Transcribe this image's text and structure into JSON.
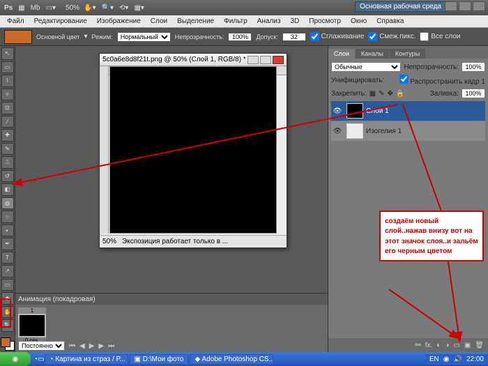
{
  "titlebar": {
    "ps": "Ps",
    "zoom": "50%",
    "workspace": "Основная рабочая среда"
  },
  "menu": {
    "file": "Файл",
    "edit": "Редактирование",
    "image": "Изображение",
    "layer": "Слои",
    "select": "Выделение",
    "filter": "Фильтр",
    "analysis": "Анализ",
    "view3d": "3D",
    "view": "Просмотр",
    "window": "Окно",
    "help": "Справка"
  },
  "options": {
    "fg_label": "Основной цвет",
    "mode_label": "Режим:",
    "mode_value": "Нормальный",
    "opacity_label": "Непрозрачность:",
    "opacity_value": "100%",
    "tolerance_label": "Допуск:",
    "tolerance_value": "32",
    "antialias": "Сглаживание",
    "contiguous": "Смеж.пикс.",
    "alllayers": "Все слои"
  },
  "document": {
    "title": "5c0a6e8d8f21t.png @ 50% (Слой 1, RGB/8) *",
    "zoom": "50%",
    "status": "Экспозиция работает только в ..."
  },
  "layers_panel": {
    "tab_layers": "Слои",
    "tab_channels": "Каналы",
    "tab_paths": "Контуры",
    "blend_mode": "Обычные",
    "opacity_label": "Непрозрачность:",
    "opacity": "100%",
    "unify_label": "Унифицировать:",
    "propagate": "Распространить кадр 1",
    "lock_label": "Закрепить:",
    "fill_label": "Заливка:",
    "fill": "100%",
    "layer1_name": "Слой 1",
    "layer2_name": "Изогелия 1"
  },
  "animation": {
    "title": "Анимация (покадровая)",
    "frame1_num": "1",
    "frame1_time": "0 сек.",
    "loop": "Постоянно"
  },
  "annotation": {
    "text": "создаём новый слой..нажав внизу вот на этот значок слоя..и зальём его черным цветом"
  },
  "taskbar": {
    "task1": "Картина из страз / Р...",
    "task2": "D:\\Мои фото",
    "task3": "Adobe Photoshop CS...",
    "lang": "EN",
    "time": "22:00"
  }
}
